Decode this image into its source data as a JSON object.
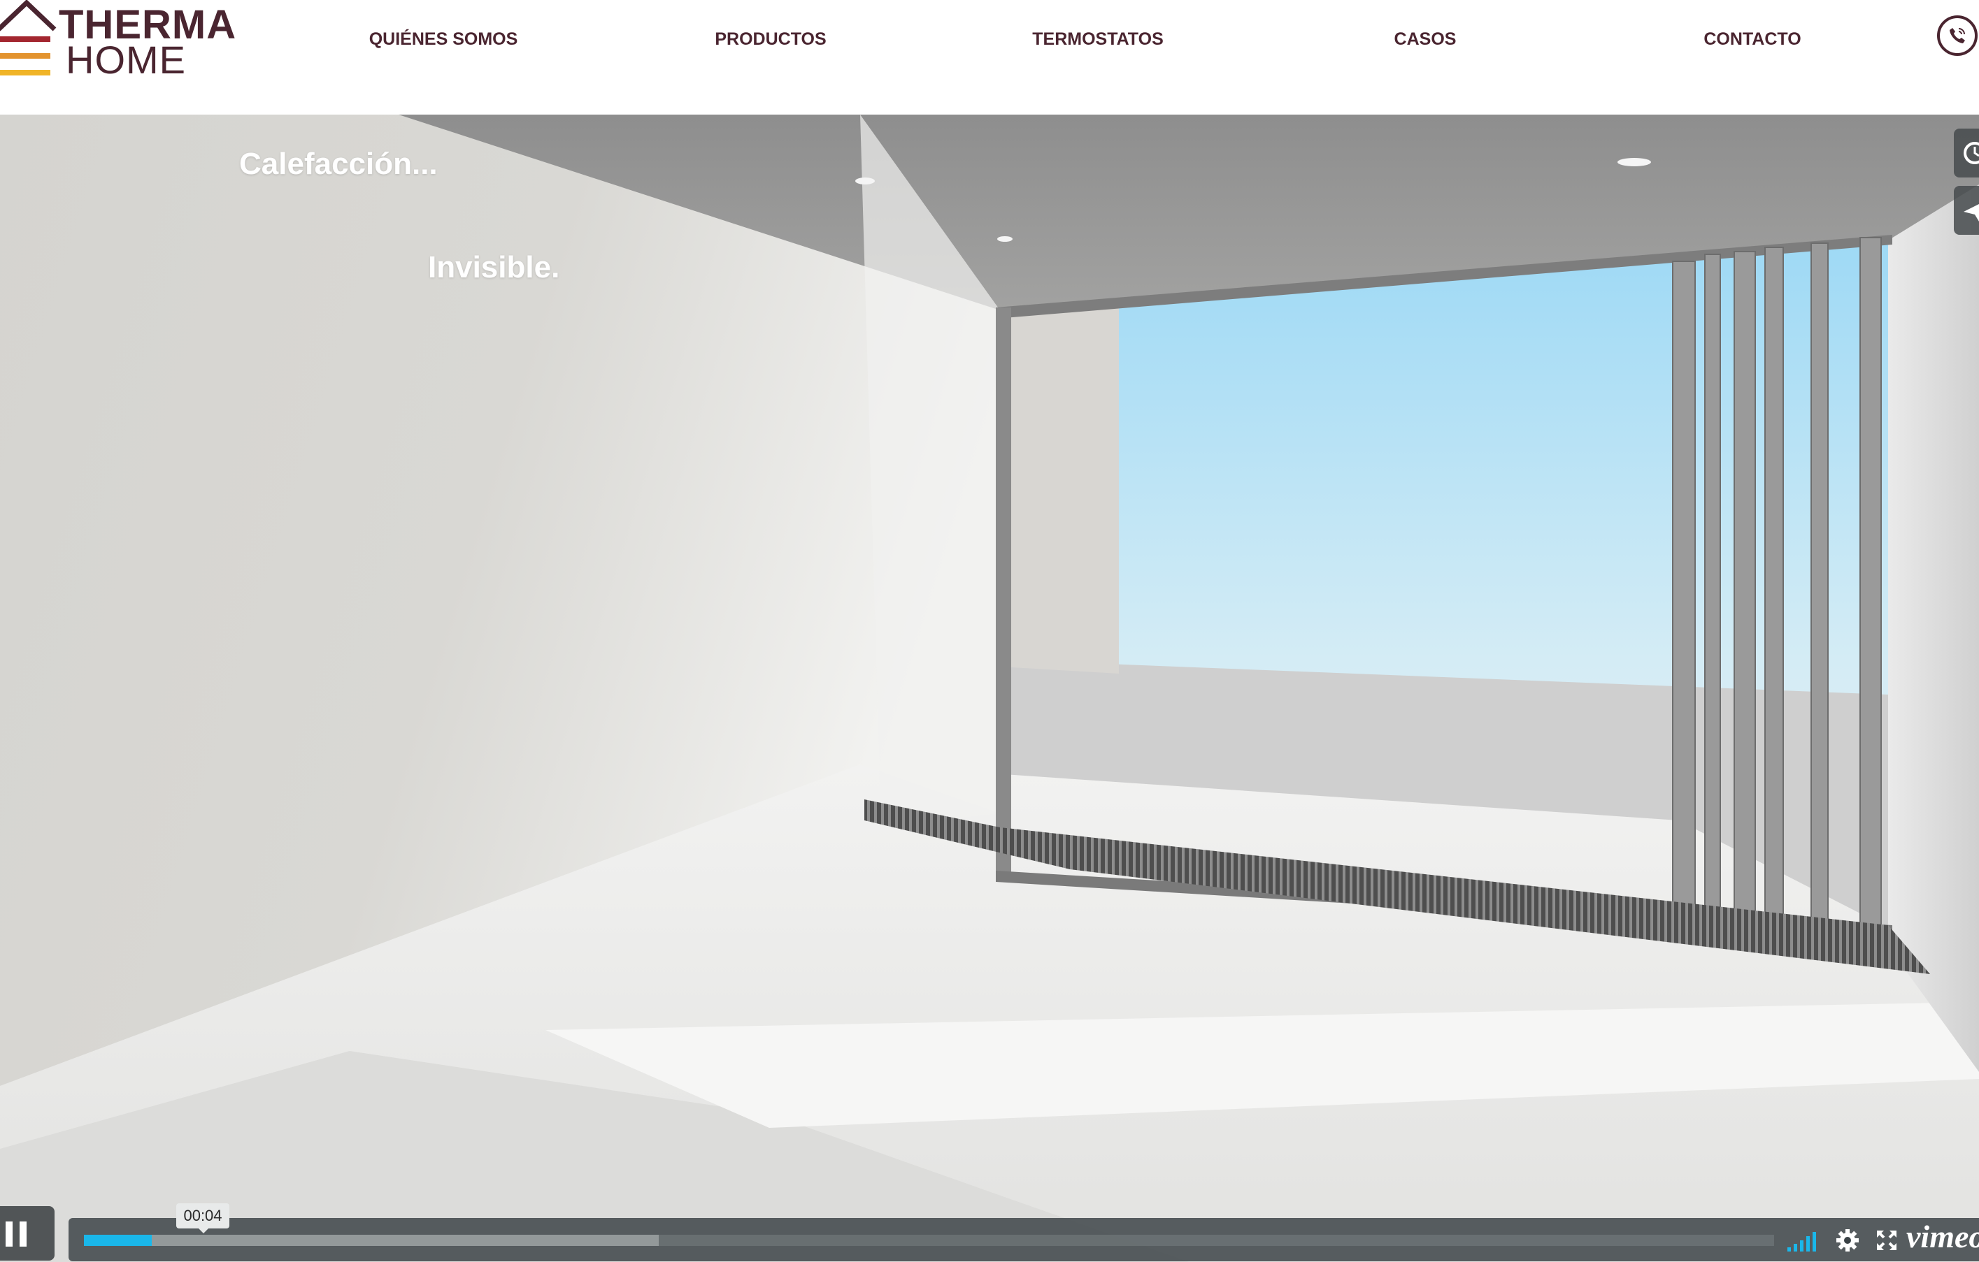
{
  "brand": {
    "line1": "THERMA",
    "line2": "HOME",
    "colors": {
      "dark": "#4a2530",
      "red": "#a3262f",
      "orange": "#e3932e",
      "yellow": "#f0b428"
    }
  },
  "nav": {
    "items": [
      {
        "label": "QUIÉNES SOMOS"
      },
      {
        "label": "PRODUCTOS"
      },
      {
        "label": "TERMOSTATOS"
      },
      {
        "label": "CASOS"
      },
      {
        "label": "CONTACTO"
      }
    ],
    "phone_icon": "phone-icon"
  },
  "hero": {
    "line1": "Calefacción...",
    "line2": "Invisible."
  },
  "player": {
    "current_time": "00:04",
    "progress_fraction": 0.04,
    "buffered_fraction": 0.34,
    "accent": "#1ab7ea",
    "brand": "vimeo",
    "icons": [
      "pause-icon",
      "volume-bars-icon",
      "gear-icon",
      "fullscreen-icon",
      "clock-icon",
      "send-icon"
    ]
  }
}
